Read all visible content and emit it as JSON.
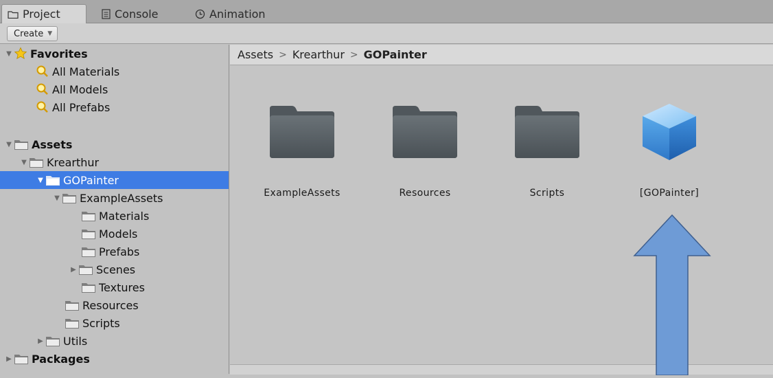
{
  "tabs": [
    {
      "label": "Project",
      "icon": "folder-icon",
      "active": true
    },
    {
      "label": "Console",
      "icon": "console-icon",
      "active": false
    },
    {
      "label": "Animation",
      "icon": "clock-icon",
      "active": false
    }
  ],
  "toolbar": {
    "create_label": "Create"
  },
  "tree": {
    "favorites": {
      "label": "Favorites",
      "items": [
        "All Materials",
        "All Models",
        "All Prefabs"
      ]
    },
    "assets_label": "Assets",
    "krearthur_label": "Krearthur",
    "gopainter_label": "GOPainter",
    "exampleassets_label": "ExampleAssets",
    "materials_label": "Materials",
    "models_label": "Models",
    "prefabs_label": "Prefabs",
    "scenes_label": "Scenes",
    "textures_label": "Textures",
    "resources_label": "Resources",
    "scripts_label": "Scripts",
    "utils_label": "Utils",
    "packages_label": "Packages"
  },
  "breadcrumb": [
    "Assets",
    "Krearthur",
    "GOPainter"
  ],
  "grid": [
    {
      "label": "ExampleAssets",
      "type": "folder"
    },
    {
      "label": "Resources",
      "type": "folder"
    },
    {
      "label": "Scripts",
      "type": "folder"
    },
    {
      "label": "[GOPainter]",
      "type": "prefab"
    }
  ],
  "colors": {
    "selection": "#3e7ce4",
    "arrow": "#6e9bd6",
    "folder": "#5a6166"
  }
}
